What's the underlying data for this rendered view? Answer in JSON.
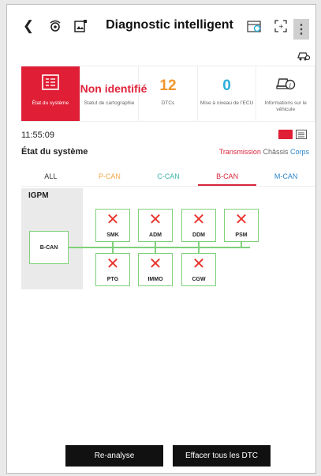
{
  "header": {
    "title": "Diagnostic intelligent",
    "back_icon": "chevron-left-icon",
    "more_icon": "vertical-dots-icon"
  },
  "tiles": [
    {
      "value": "",
      "label": "État du système",
      "active": true
    },
    {
      "value": "Non identifié",
      "label": "Statut de cartographie"
    },
    {
      "value": "12",
      "label": "DTCs"
    },
    {
      "value": "0",
      "label": "Mise à niveau de l'ECU"
    },
    {
      "value": "",
      "label": "Informations sur le véhicule"
    }
  ],
  "status": {
    "time": "11:55:09",
    "title": "État du système",
    "filters": {
      "transmission": "Transmission",
      "chassis": "Châssis",
      "corps": "Corps"
    }
  },
  "tabs": [
    "ALL",
    "P-CAN",
    "C-CAN",
    "B-CAN",
    "M-CAN"
  ],
  "diagram": {
    "ecu": "IGPM",
    "bus": "B-CAN",
    "top_nodes": [
      "SMK",
      "ADM",
      "DDM",
      "PSM"
    ],
    "bottom_nodes": [
      "PTG",
      "IMMO",
      "CGW"
    ]
  },
  "buttons": {
    "reanalyse": "Re-analyse",
    "clear_dtc": "Effacer tous les DTC"
  },
  "colors": {
    "accent_red": "#e01e35",
    "teal": "#2ab0d9",
    "node_border": "#7fd07a",
    "fault_x": "#e8362d"
  }
}
